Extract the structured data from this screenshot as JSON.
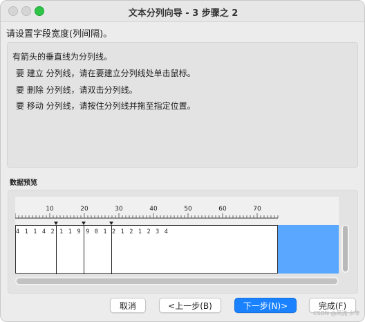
{
  "window": {
    "title": "文本分列向导 - 3 步骤之 2"
  },
  "instruction": "请设置字段宽度(列间隔)。",
  "description": {
    "lines": [
      "有箭头的垂直线为分列线。",
      "要 建立 分列线，请在要建立分列线处单击鼠标。",
      "要 删除 分列线，请双击分列线。",
      "要 移动 分列线，请按住分列线并拖至指定位置。"
    ]
  },
  "preview": {
    "label": "数据预览",
    "ruler_ticks": [
      "10",
      "20",
      "30",
      "40",
      "50",
      "60",
      "70"
    ],
    "data_row": "4 1 1 4 2 1 1 9 9 0 1 2 1 2 1 2 3 4"
  },
  "buttons": {
    "cancel": "取消",
    "back": "<上一步(B)",
    "next": "下一步(N)>",
    "finish": "完成(F)"
  },
  "watermark": "CSDN @风流 少年",
  "colors": {
    "accent": "#1a82ff",
    "selection": "#5aa7ff"
  }
}
